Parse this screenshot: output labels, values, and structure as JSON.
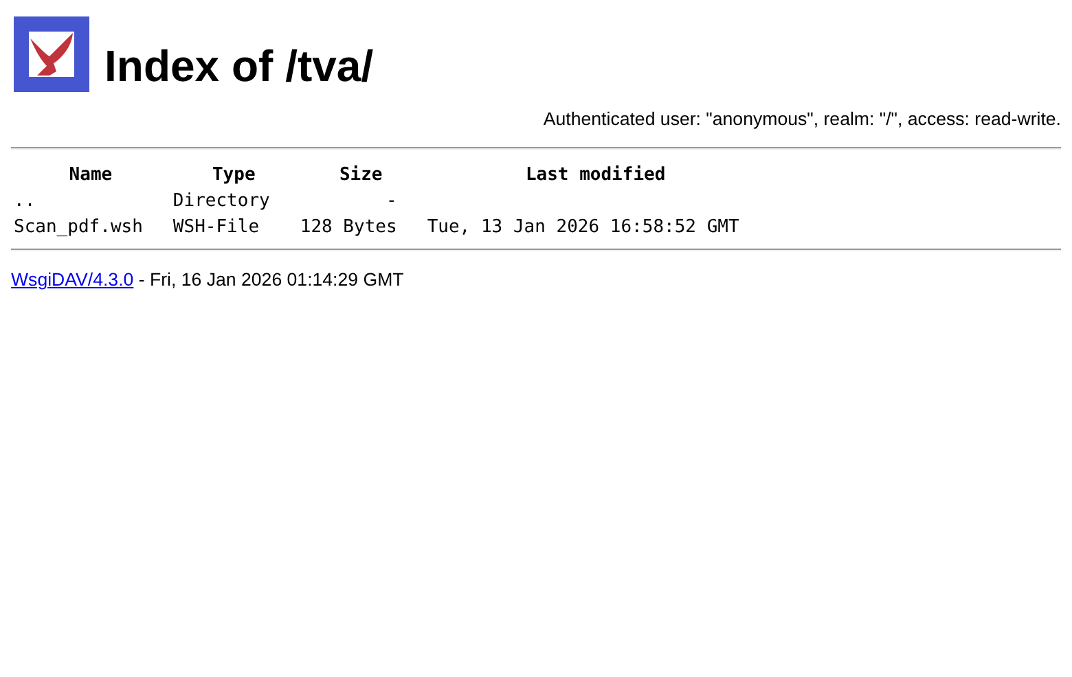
{
  "title": "Index of /tva/",
  "auth_note": "Authenticated user: \"anonymous\", realm: \"/\", access: read-write.",
  "table": {
    "columns": [
      "Name",
      "Type",
      "Size",
      "Last modified"
    ],
    "rows": [
      {
        "name": "..",
        "type": "Directory",
        "size": "-"
      },
      {
        "name": "Scan_pdf.wsh",
        "type": "WSH-File",
        "size": "128 Bytes",
        "modified": "Tue, 13 Jan 2026 16:58:52 GMT"
      }
    ]
  },
  "footer": {
    "link": "WsgiDAV/4.3.0",
    "text": "- Fri, 16 Jan 2026 01:14:29 GMT"
  }
}
